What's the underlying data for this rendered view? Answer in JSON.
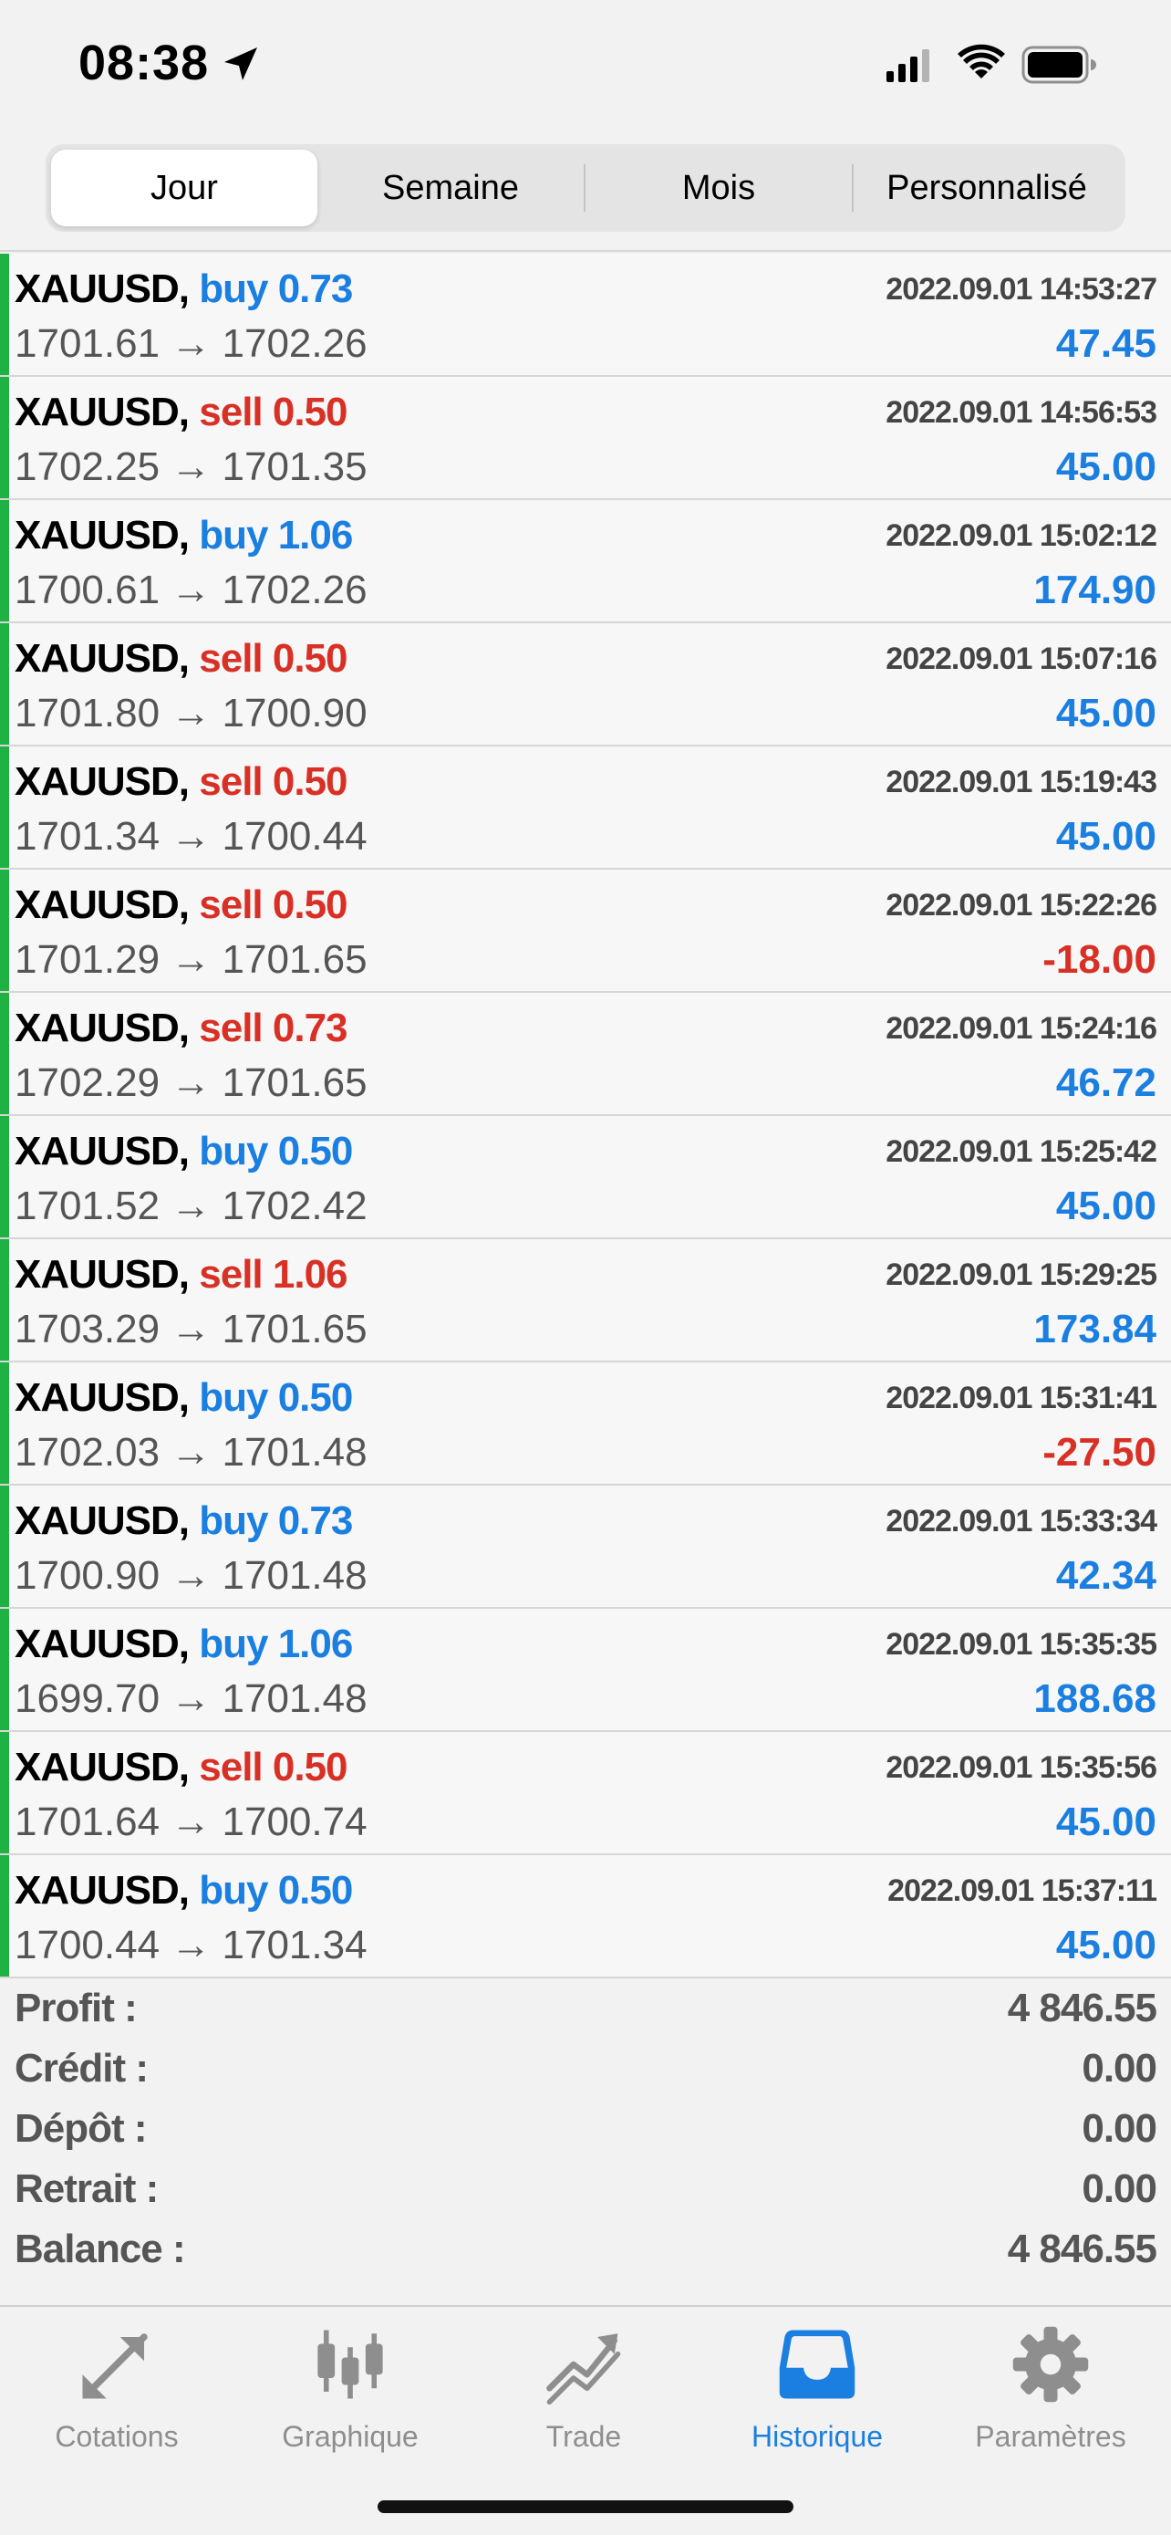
{
  "status_bar": {
    "time": "08:38"
  },
  "segments": [
    {
      "label": "Jour",
      "active": true
    },
    {
      "label": "Semaine",
      "active": false
    },
    {
      "label": "Mois",
      "active": false
    },
    {
      "label": "Personnalisé",
      "active": false
    }
  ],
  "trades": [
    {
      "symbol": "XAUUSD,",
      "side": "buy",
      "volume": "buy 0.73",
      "time": "2022.09.01 14:53:27",
      "prices": "1701.61 → 1702.26",
      "profit": "47.45"
    },
    {
      "symbol": "XAUUSD,",
      "side": "sell",
      "volume": "sell 0.50",
      "time": "2022.09.01 14:56:53",
      "prices": "1702.25 → 1701.35",
      "profit": "45.00"
    },
    {
      "symbol": "XAUUSD,",
      "side": "buy",
      "volume": "buy 1.06",
      "time": "2022.09.01 15:02:12",
      "prices": "1700.61 → 1702.26",
      "profit": "174.90"
    },
    {
      "symbol": "XAUUSD,",
      "side": "sell",
      "volume": "sell 0.50",
      "time": "2022.09.01 15:07:16",
      "prices": "1701.80 → 1700.90",
      "profit": "45.00"
    },
    {
      "symbol": "XAUUSD,",
      "side": "sell",
      "volume": "sell 0.50",
      "time": "2022.09.01 15:19:43",
      "prices": "1701.34 → 1700.44",
      "profit": "45.00"
    },
    {
      "symbol": "XAUUSD,",
      "side": "sell",
      "volume": "sell 0.50",
      "time": "2022.09.01 15:22:26",
      "prices": "1701.29 → 1701.65",
      "profit": "-18.00"
    },
    {
      "symbol": "XAUUSD,",
      "side": "sell",
      "volume": "sell 0.73",
      "time": "2022.09.01 15:24:16",
      "prices": "1702.29 → 1701.65",
      "profit": "46.72"
    },
    {
      "symbol": "XAUUSD,",
      "side": "buy",
      "volume": "buy 0.50",
      "time": "2022.09.01 15:25:42",
      "prices": "1701.52 → 1702.42",
      "profit": "45.00"
    },
    {
      "symbol": "XAUUSD,",
      "side": "sell",
      "volume": "sell 1.06",
      "time": "2022.09.01 15:29:25",
      "prices": "1703.29 → 1701.65",
      "profit": "173.84"
    },
    {
      "symbol": "XAUUSD,",
      "side": "buy",
      "volume": "buy 0.50",
      "time": "2022.09.01 15:31:41",
      "prices": "1702.03 → 1701.48",
      "profit": "-27.50"
    },
    {
      "symbol": "XAUUSD,",
      "side": "buy",
      "volume": "buy 0.73",
      "time": "2022.09.01 15:33:34",
      "prices": "1700.90 → 1701.48",
      "profit": "42.34"
    },
    {
      "symbol": "XAUUSD,",
      "side": "buy",
      "volume": "buy 1.06",
      "time": "2022.09.01 15:35:35",
      "prices": "1699.70 → 1701.48",
      "profit": "188.68"
    },
    {
      "symbol": "XAUUSD,",
      "side": "sell",
      "volume": "sell 0.50",
      "time": "2022.09.01 15:35:56",
      "prices": "1701.64 → 1700.74",
      "profit": "45.00"
    },
    {
      "symbol": "XAUUSD,",
      "side": "buy",
      "volume": "buy 0.50",
      "time": "2022.09.01 15:37:11",
      "prices": "1700.44 → 1701.34",
      "profit": "45.00"
    }
  ],
  "summary": [
    {
      "label": "Profit :",
      "value": "4 846.55"
    },
    {
      "label": "Crédit :",
      "value": "0.00"
    },
    {
      "label": "Dépôt :",
      "value": "0.00"
    },
    {
      "label": "Retrait :",
      "value": "0.00"
    },
    {
      "label": "Balance :",
      "value": "4 846.55"
    }
  ],
  "tabs": [
    {
      "label": "Cotations",
      "icon": "quotes-arrows-icon",
      "active": false
    },
    {
      "label": "Graphique",
      "icon": "candlestick-chart-icon",
      "active": false
    },
    {
      "label": "Trade",
      "icon": "trade-trend-icon",
      "active": false
    },
    {
      "label": "Historique",
      "icon": "inbox-tray-icon",
      "active": true
    },
    {
      "label": "Paramètres",
      "icon": "gear-icon",
      "active": false
    }
  ],
  "colors": {
    "buy": "#1a7fe0",
    "sell": "#d93025",
    "profit_positive": "#1a7fe0",
    "profit_negative": "#d93025",
    "row_bar": "#1fb141",
    "tab_active": "#1a7fe0",
    "tab_inactive": "#8e8e8e"
  }
}
